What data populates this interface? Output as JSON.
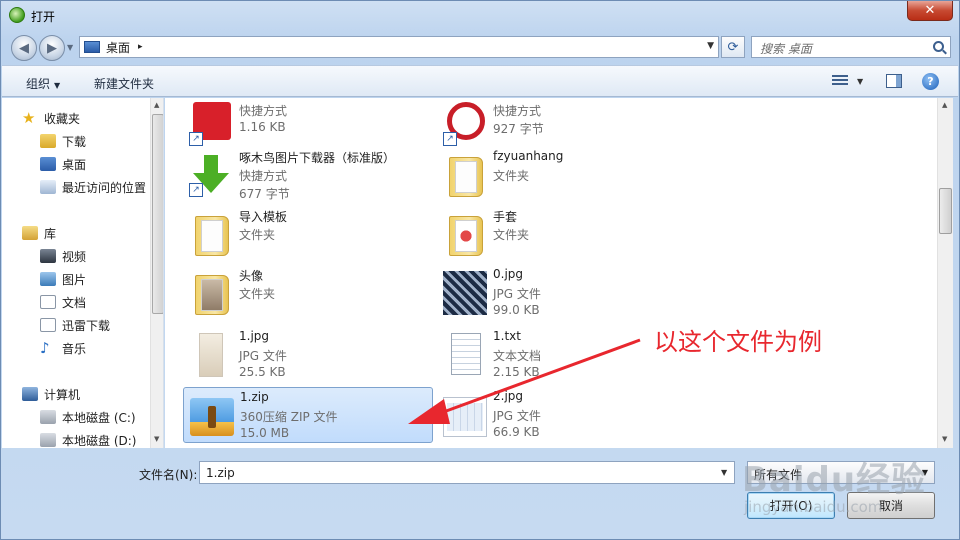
{
  "window": {
    "title": "打开",
    "close_label": "✕"
  },
  "address": {
    "location": "桌面",
    "separator": "▸"
  },
  "search": {
    "placeholder": "搜索 桌面"
  },
  "toolbar": {
    "organize": "组织",
    "new_folder": "新建文件夹",
    "help": "?"
  },
  "sidebar": {
    "favorites": "收藏夹",
    "downloads": "下载",
    "desktop": "桌面",
    "recent": "最近访问的位置",
    "library": "库",
    "videos": "视频",
    "pictures": "图片",
    "documents": "文档",
    "xunlei": "迅雷下载",
    "music": "音乐",
    "computer": "计算机",
    "disk_c": "本地磁盘 (C:)",
    "disk_d": "本地磁盘 (D:)"
  },
  "files": [
    {
      "name": "",
      "type": "快捷方式",
      "size": "1.16 KB"
    },
    {
      "name": "",
      "type": "快捷方式",
      "size": "927 字节"
    },
    {
      "name": "啄木鸟图片下载器（标准版）",
      "type": "快捷方式",
      "size": "677 字节"
    },
    {
      "name": "fzyuanhang",
      "type": "文件夹",
      "size": ""
    },
    {
      "name": "导入模板",
      "type": "文件夹",
      "size": ""
    },
    {
      "name": "手套",
      "type": "文件夹",
      "size": ""
    },
    {
      "name": "头像",
      "type": "文件夹",
      "size": ""
    },
    {
      "name": "0.jpg",
      "type": "JPG 文件",
      "size": "99.0 KB"
    },
    {
      "name": "1.jpg",
      "type": "JPG 文件",
      "size": "25.5 KB"
    },
    {
      "name": "1.txt",
      "type": "文本文档",
      "size": "2.15 KB"
    },
    {
      "name": "1.zip",
      "type": "360压缩 ZIP 文件",
      "size": "15.0 MB"
    },
    {
      "name": "2.jpg",
      "type": "JPG 文件",
      "size": "66.9 KB"
    }
  ],
  "bottom": {
    "filename_label": "文件名(N):",
    "filename_value": "1.zip",
    "filter_value": "所有文件",
    "open_button": "打开(O)",
    "cancel_button": "取消"
  },
  "annotation": {
    "text": "以这个文件为例",
    "color": "#e8272e"
  },
  "watermark": {
    "main": "Baidu经验",
    "sub": "jingyan.baidu.com"
  }
}
